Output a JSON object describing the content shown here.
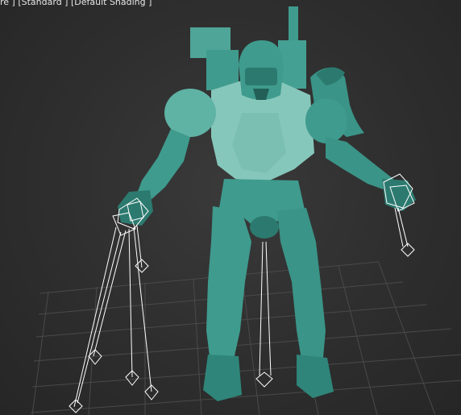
{
  "viewport": {
    "label_parts": [
      "re ]",
      " [Standard ]",
      " [Default Shading ]"
    ],
    "background_color": "#2e2e2e",
    "grid_color": "#4a4a4a",
    "model_color": "#3f9b8e",
    "model_shadow_color": "#2c7a6f",
    "model_highlight_color": "#6fbfb2",
    "rig_color": "#ffffff",
    "icons": {
      "model": "armored-character-model-icon",
      "rig": "ik-helper-wireframe-icon"
    }
  }
}
